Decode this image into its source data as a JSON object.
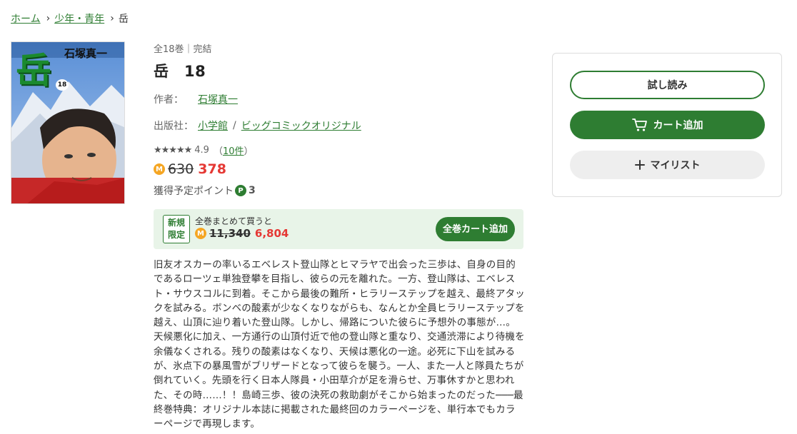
{
  "breadcrumb": {
    "home": "ホーム",
    "category": "少年・青年",
    "current": "岳"
  },
  "book": {
    "cover_title": "岳",
    "cover_author": "石塚真一",
    "cover_volume": "18",
    "volumes_status": "全18巻｜完結",
    "title": "岳　18",
    "author_label": "作者：",
    "author": "石塚真一",
    "publisher_label": "出版社：",
    "publisher": "小学館",
    "slash": "/",
    "label": "ビッグコミックオリジナル",
    "stars": "★★★★★",
    "rating": "4.9",
    "review_count_open": "（",
    "review_count": "10件",
    "review_count_close": "）",
    "coin_mark": "M",
    "price_old": "630",
    "price_new": "378",
    "points_label": "獲得予定ポイント",
    "points_mark": "P",
    "points": "3"
  },
  "bundle": {
    "tag_line1": "新規",
    "tag_line2": "限定",
    "label": "全巻まとめて買うと",
    "coin_mark": "M",
    "price_old": "11,340",
    "price_new": "6,804",
    "button": "全巻カート追加"
  },
  "description": "旧友オスカーの率いるエベレスト登山隊とヒマラヤで出会った三歩は、自身の目的であるローツェ単独登攀を目指し、彼らの元を離れた。一方、登山隊は、エベレスト・サウスコルに到着。そこから最後の難所・ヒラリーステップを越え、最終アタックを試みる。ボンベの酸素が少なくなりながらも、なんとか全員ヒラリーステップを越え、山頂に辿り着いた登山隊。しかし、帰路についた彼らに予想外の事態が…。天候悪化に加え、一方通行の山頂付近で他の登山隊と重なり、交通渋滞により待機を余儀なくされる。残りの酸素はなくなり、天候は悪化の一途。必死に下山を試みるが、氷点下の暴風雪がブリザードとなって彼らを襲う。一人、また一人と隊員たちが倒れていく。先頭を行く日本人隊員・小田草介が足を滑らせ、万事休すかと思われた、その時……！！島崎三歩、彼の決死の救助劇がそこから始まったのだった───最終巻特典：オリジナル本誌に掲載された最終回のカラーページを、単行本でもカラーページで再現します。",
  "actions": {
    "trial": "試し読み",
    "cart": "カート追加",
    "mylist": "マイリスト"
  },
  "colors": {
    "accent": "#2e7d32",
    "price": "#e53935",
    "coin": "#f5a623"
  }
}
